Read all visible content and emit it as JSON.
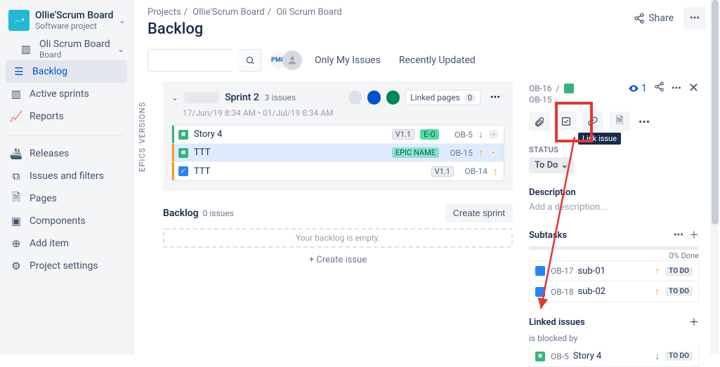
{
  "project": {
    "name": "Ollie'Scrum Board",
    "type": "Software project"
  },
  "board": {
    "name": "Oli Scrum Board",
    "sub": "Board"
  },
  "nav": {
    "backlog": "Backlog",
    "active": "Active sprints",
    "reports": "Reports",
    "releases": "Releases",
    "issues": "Issues and filters",
    "pages": "Pages",
    "components": "Components",
    "additem": "Add item",
    "settings": "Project settings"
  },
  "crumbs": {
    "a": "Projects",
    "b": "Ollie'Scrum Board",
    "c": "Oli Scrum Board"
  },
  "page_title": "Backlog",
  "share": "Share",
  "filters": {
    "mine": "Only My Issues",
    "recent": "Recently Updated"
  },
  "vtabs": {
    "versions": "VERSIONS",
    "epics": "EPICS"
  },
  "sprint": {
    "name": "Sprint 2",
    "count": "3 issues",
    "dates": "17/Jun/19 8:34 AM • 01/Jul/19 8:34 AM",
    "linked_pages_label": "Linked pages",
    "linked_pages_count": "0",
    "rows": [
      {
        "bar": "green",
        "type": "story",
        "title": "Story 4",
        "v": "V1.1",
        "epic": "",
        "eo": "E-O",
        "key": "OB-5",
        "prio": "down",
        "dash": "-"
      },
      {
        "bar": "orange",
        "type": "story",
        "title": "TTT",
        "v": "",
        "epic": "EPIC NAME",
        "eo": "",
        "key": "OB-15",
        "prio": "up",
        "dash": "-"
      },
      {
        "bar": "orange",
        "type": "task",
        "title": "TTT",
        "v": "V1.1",
        "epic": "",
        "eo": "",
        "key": "OB-14",
        "prio": "up",
        "dash": ""
      }
    ]
  },
  "backlog": {
    "label": "Backlog",
    "count": "0 issues",
    "empty": "Your backlog is empty.",
    "create_sprint": "Create sprint",
    "create_issue": "+  Create issue"
  },
  "detail": {
    "parent_key": "OB-16",
    "key": "OB-15",
    "watch": "1",
    "link_tooltip": "Link issue",
    "status_label": "STATUS",
    "status_value": "To Do",
    "description_label": "Description",
    "description_placeholder": "Add a description...",
    "subtasks_label": "Subtasks",
    "progress_pct": "0% Done",
    "subtasks": [
      {
        "key": "OB-17",
        "title": "sub-01",
        "status": "TO DO"
      },
      {
        "key": "OB-18",
        "title": "sub-02",
        "status": "TO DO"
      }
    ],
    "linked_label": "Linked issues",
    "blocked_by": "is blocked by",
    "linked": [
      {
        "key": "OB-5",
        "title": "Story 4",
        "status": "TO DO"
      }
    ]
  }
}
